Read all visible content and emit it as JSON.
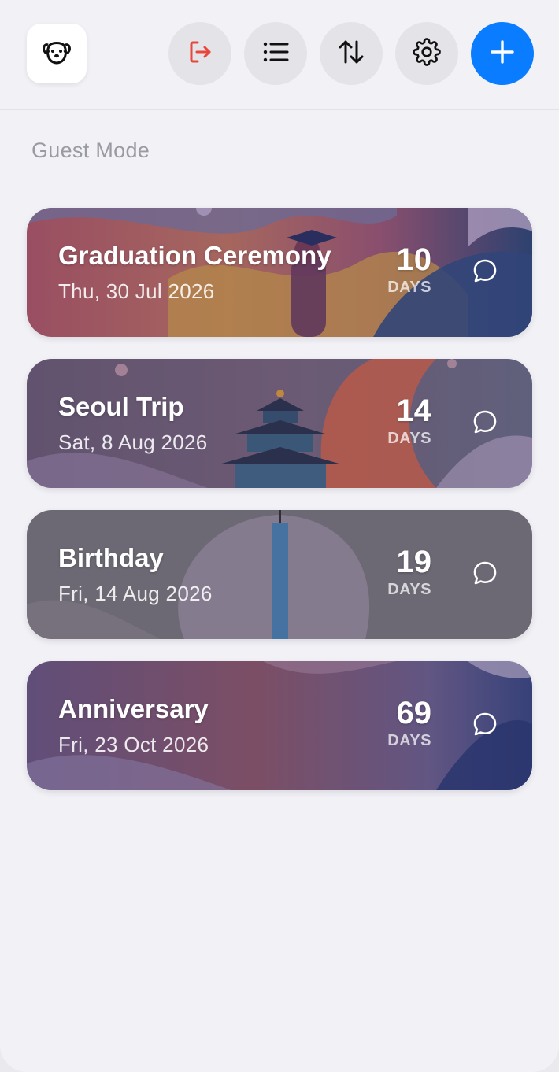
{
  "header": {
    "logo_icon": "dog-face-icon",
    "buttons": [
      {
        "name": "logout",
        "icon": "logout-icon",
        "color": "#e8473c"
      },
      {
        "name": "list",
        "icon": "list-icon",
        "color": "#111111"
      },
      {
        "name": "sort",
        "icon": "sort-icon",
        "color": "#111111"
      },
      {
        "name": "settings",
        "icon": "gear-icon",
        "color": "#111111"
      },
      {
        "name": "add",
        "icon": "plus-icon",
        "color": "#ffffff",
        "background": "#0a7cff"
      }
    ]
  },
  "mode_label": "Guest Mode",
  "events": [
    {
      "title": "Graduation Ceremony",
      "date": "Thu, 30 Jul 2026",
      "count": "10",
      "unit": "DAYS",
      "background_icon": "graduate-silhouette-icon"
    },
    {
      "title": "Seoul Trip",
      "date": "Sat, 8 Aug 2026",
      "count": "14",
      "unit": "DAYS",
      "background_icon": "pagoda-icon"
    },
    {
      "title": "Birthday",
      "date": "Fri, 14 Aug 2026",
      "count": "19",
      "unit": "DAYS",
      "background_icon": "candle-icon"
    },
    {
      "title": "Anniversary",
      "date": "Fri, 23 Oct 2026",
      "count": "69",
      "unit": "DAYS",
      "background_icon": "abstract-shapes-icon"
    }
  ],
  "colors": {
    "accent": "#0a7cff",
    "logout": "#e8473c",
    "page_background": "#f1f1f6",
    "muted_text": "#9a9aa3"
  }
}
